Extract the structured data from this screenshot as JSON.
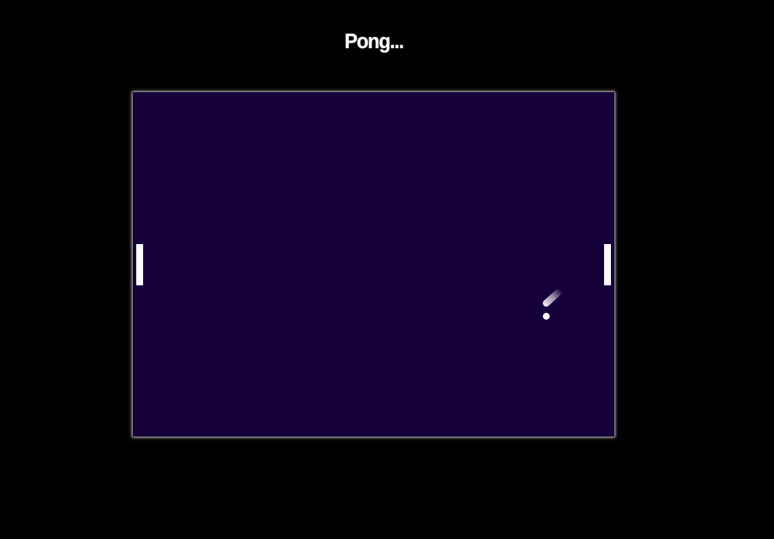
{
  "title": "Pong...",
  "colors": {
    "page_background": "#000000",
    "board_background": "#16003a",
    "paddle": "#ffffff",
    "ball": "#ffffff",
    "title": "#ffffff"
  },
  "icons": {
    "left_paddle": "paddle",
    "right_paddle": "paddle",
    "ball": "ball-with-motion-trail"
  }
}
